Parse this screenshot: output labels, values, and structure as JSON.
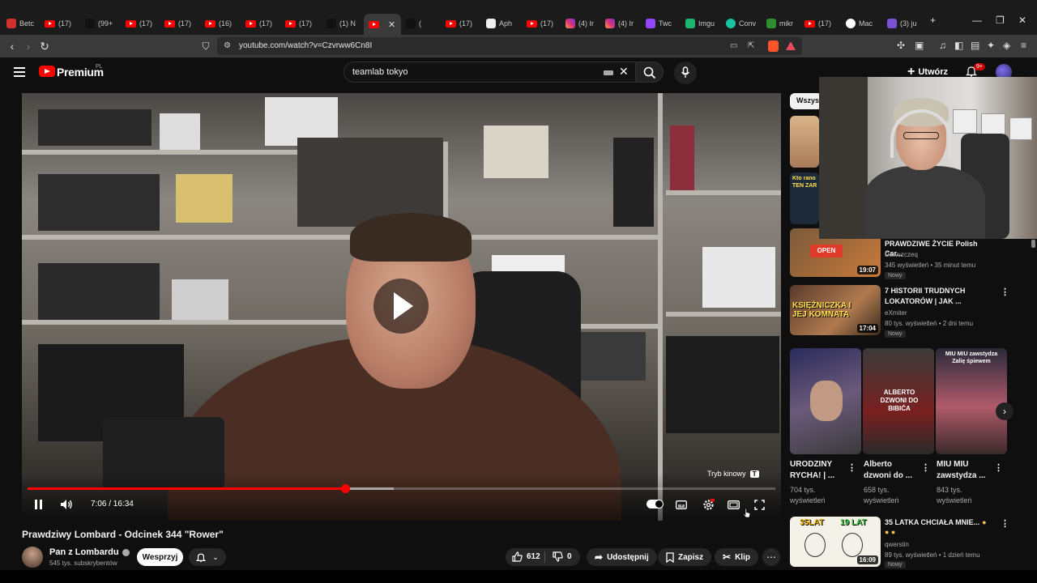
{
  "browser": {
    "tabs": [
      {
        "label": "Betc",
        "kind": "red"
      },
      {
        "label": "(17)",
        "kind": "yt"
      },
      {
        "label": "(99+",
        "kind": "tiktok"
      },
      {
        "label": "(17)",
        "kind": "yt"
      },
      {
        "label": "(17)",
        "kind": "yt"
      },
      {
        "label": "(16)",
        "kind": "yt"
      },
      {
        "label": "(17)",
        "kind": "yt"
      },
      {
        "label": "(17)",
        "kind": "yt"
      },
      {
        "label": "(1) N",
        "kind": "x"
      },
      {
        "label": "",
        "kind": "yt"
      },
      {
        "label": "(",
        "kind": "tiktok"
      },
      {
        "label": "(17)",
        "kind": "yt"
      },
      {
        "label": "Aph",
        "kind": "white"
      },
      {
        "label": "(17)",
        "kind": "yt"
      },
      {
        "label": "(4) Ir",
        "kind": "ig"
      },
      {
        "label": "(4) Ir",
        "kind": "ig"
      },
      {
        "label": "Twc",
        "kind": "twitch"
      },
      {
        "label": "Imgu",
        "kind": "green"
      },
      {
        "label": "Conv",
        "kind": "teal"
      },
      {
        "label": "mikr",
        "kind": "lime"
      },
      {
        "label": "(17)",
        "kind": "yt"
      },
      {
        "label": "Mac",
        "kind": "google"
      },
      {
        "label": "(3) ju",
        "kind": "purple"
      }
    ],
    "url": "youtube.com/watch?v=Czvrww6Cn8I"
  },
  "header": {
    "brand": "Premium",
    "region": "PL",
    "search_value": "teamlab tokyo",
    "create_label": "Utwórz",
    "notif_count": "9+"
  },
  "player": {
    "time": "7:06 / 16:34",
    "progress": 0.425,
    "buffered": 0.49,
    "cinema_tooltip": "Tryb kinowy",
    "cinema_key": "T"
  },
  "video": {
    "title": "Prawdziwy Lombard - Odcinek 344 \"Rower\"",
    "channel": "Pan z Lombardu",
    "subscribers": "545 tys. subskrybentów",
    "support_label": "Wesprzyj",
    "likes": "612",
    "dislikes": "0",
    "share_label": "Udostępnij",
    "save_label": "Zapisz",
    "clip_label": "Klip"
  },
  "sidebar": {
    "chip_all": "Wszystko",
    "videos": [
      {
        "title1": "PRAWDZIWE ŻYCIE Polish Car...",
        "title2": "",
        "channel": "Dawszczeq",
        "meta": "345 wyświetleń • 35 minut temu",
        "badge": "Nowy",
        "duration": "19:07",
        "thumb_text": "OPEN"
      },
      {
        "title1": "7 HISTORII TRUDNYCH",
        "title2": "LOKATORÓW | JAK ...",
        "channel": "eXmiter",
        "meta": "80 tys. wyświetleń • 2 dni temu",
        "badge": "Nowy",
        "duration": "17:04",
        "thumb_text": "KSIĘŻNICZKA I JEJ KOMNATA"
      },
      {
        "title1": "35 LATKA CHCIAŁA MNIE...",
        "title2": "",
        "channel": "qwerstin",
        "meta": "89 tys. wyświetleń • 1 dzień temu",
        "badge": "Nowy",
        "duration": "16:09",
        "thumb_text_left": "35LAT",
        "thumb_text_right": "19 LAT"
      }
    ],
    "partial_thumbs": [
      {
        "text": ""
      },
      {
        "text": "Kto rano TEN ZAR"
      },
      {
        "text": ""
      }
    ],
    "shorts": [
      {
        "title1": "URODZINY",
        "title2": "RYCHA! | ...",
        "views1": "704 tys.",
        "views2": "wyświetleń",
        "thumb_text": ""
      },
      {
        "title1": "Alberto",
        "title2": "dzwoni do ...",
        "views1": "658 tys.",
        "views2": "wyświetleń",
        "thumb_text": "ALBERTO DZWONI DO BIBIĆA"
      },
      {
        "title1": "MIU MIU",
        "title2": "zawstydza ...",
        "views1": "843 tys.",
        "views2": "wyświetleń",
        "thumb_text": "MIU MIU zawstydza Zalię śpiewem"
      }
    ]
  },
  "colors": {
    "accent": "#ff0000",
    "background": "#0f0f0f",
    "surface": "#272727"
  }
}
